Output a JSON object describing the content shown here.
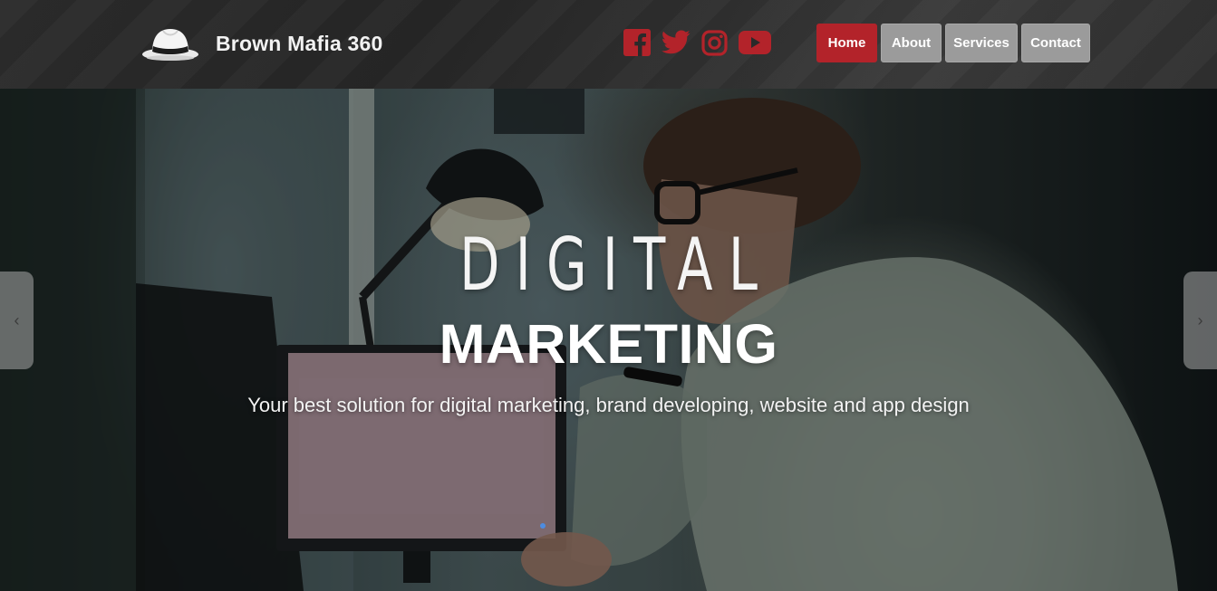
{
  "brand": {
    "name": "Brown Mafia 360",
    "logo_icon": "fedora-hat-icon"
  },
  "social": [
    {
      "name": "facebook-icon",
      "color": "#b3232a"
    },
    {
      "name": "twitter-icon",
      "color": "#b3232a"
    },
    {
      "name": "instagram-icon",
      "color": "#b3232a"
    },
    {
      "name": "youtube-icon",
      "color": "#b3232a"
    }
  ],
  "nav": {
    "items": [
      {
        "label": "Home",
        "active": true
      },
      {
        "label": "About",
        "active": false
      },
      {
        "label": "Services",
        "active": false
      },
      {
        "label": "Contact",
        "active": false
      }
    ],
    "active_color": "#b3232a",
    "inactive_color": "#9b9b9b"
  },
  "hero": {
    "title_top": "DIGITAL",
    "title_bottom": "MARKETING",
    "subtitle": "Your best solution for digital marketing, brand developing, website and app design",
    "prev_arrow": "‹",
    "next_arrow": "›"
  }
}
